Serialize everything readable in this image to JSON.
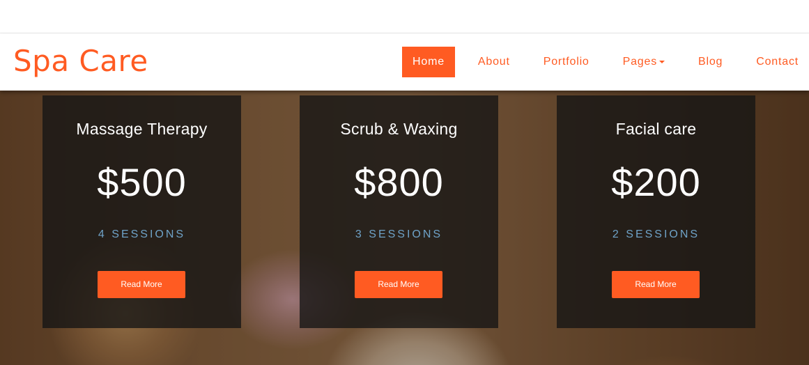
{
  "brand": {
    "name": "Spa Care",
    "accent_color": "#ff5b22",
    "session_color": "#6fa3c8"
  },
  "nav": {
    "items": [
      {
        "label": "Home",
        "active": true
      },
      {
        "label": "About",
        "active": false
      },
      {
        "label": "Portfolio",
        "active": false
      },
      {
        "label": "Pages",
        "active": false,
        "has_dropdown": true,
        "icon": "caret-down-icon"
      },
      {
        "label": "Blog",
        "active": false
      },
      {
        "label": "Contact",
        "active": false
      }
    ]
  },
  "pricing": [
    {
      "title": "Massage Therapy",
      "price": "$500",
      "sessions": "4 SESSIONS",
      "button": "Read More"
    },
    {
      "title": "Scrub & Waxing",
      "price": "$800",
      "sessions": "3 SESSIONS",
      "button": "Read More"
    },
    {
      "title": "Facial care",
      "price": "$200",
      "sessions": "2 SESSIONS",
      "button": "Read More"
    }
  ]
}
